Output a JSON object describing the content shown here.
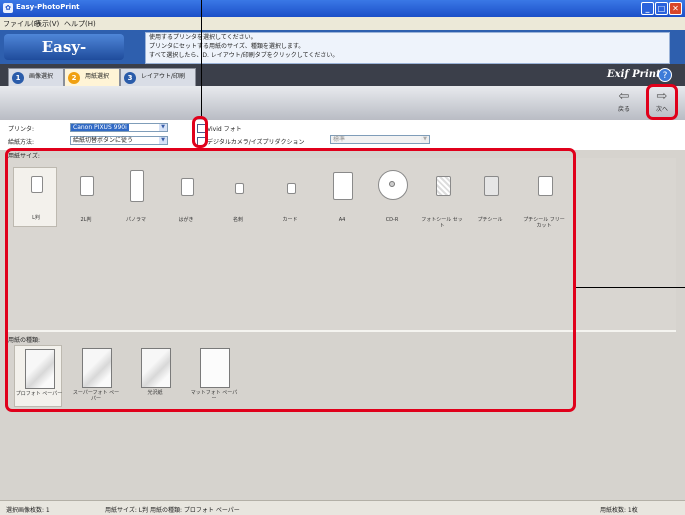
{
  "window": {
    "title": "Easy-PhotoPrint",
    "icon": "app-icon"
  },
  "menu": [
    "ファイル(F)",
    "表示(V)",
    "ヘルプ(H)"
  ],
  "banner": {
    "logo": "Easy-PhotoPrint",
    "instructions": [
      "使用するプリンタを選択してください。",
      "プリンタにセットする用紙のサイズ、種類を選択します。",
      "すべて選択したら、D. レイアウト/印刷タブをクリックしてください。"
    ]
  },
  "tabs": [
    {
      "num": "1",
      "label": "画像選択"
    },
    {
      "num": "2",
      "label": "用紙選択"
    },
    {
      "num": "3",
      "label": "レイアウト/印刷"
    }
  ],
  "brand": {
    "exif": "Exif Print",
    "help": "?"
  },
  "nav": {
    "back_label": "戻る",
    "next_label": "次へ"
  },
  "settings": {
    "printer_label": "プリンタ:",
    "printer_value": "Canon PIXUS 990i",
    "feed_label": "給紙方法:",
    "feed_value": "給紙切替ボタンに従う",
    "vivid_label": "Vivid フォト",
    "dpof_label": "デジタルカメラ/イズプリダクション",
    "standard_value": "標準"
  },
  "sizes_heading": "用紙サイズ:",
  "paper_sizes": [
    "L判",
    "2L判",
    "パノラマ",
    "はがき",
    "名刺",
    "カード",
    "A4",
    "CD-R",
    "フォトシール セット",
    "プチシール",
    "プチシール フリーカット"
  ],
  "type_heading": "用紙の種類:",
  "paper_types": [
    "プロフォト ペーパー",
    "スーパーフォト ペーパー",
    "光沢紙",
    "マットフォト ペーパー"
  ],
  "status": {
    "count": "選択画像枚数: 1",
    "selection": "用紙サイズ: L判  用紙の種類: プロフォト ペーパー",
    "paper_count": "用紙枚数: 1枚"
  },
  "colors": {
    "highlight": "#e0001b",
    "titlebar": "#1c4fc8",
    "banner": "#2e5fae",
    "panel": "#d9d6d1"
  }
}
